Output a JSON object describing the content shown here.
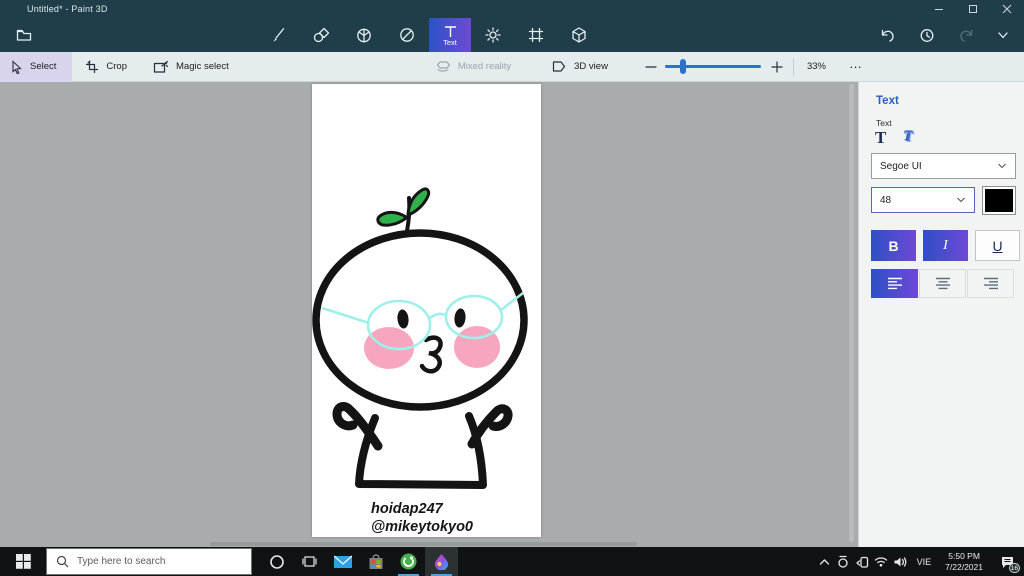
{
  "window": {
    "title": "Untitled* - Paint 3D"
  },
  "ribbon": {
    "text_tool_label": "Text",
    "tools": [
      "menu",
      "brushes",
      "2d-shapes",
      "3d-shapes",
      "stickers",
      "text",
      "effects",
      "canvas",
      "3d-library"
    ],
    "history_icons": [
      "undo",
      "history",
      "redo",
      "expand"
    ]
  },
  "subtoolbar": {
    "select": "Select",
    "crop": "Crop",
    "magic_select": "Magic select",
    "mixed_reality": "Mixed reality",
    "view_3d": "3D view",
    "zoom_percent": "33%",
    "more": "…"
  },
  "right_panel": {
    "header": "Text",
    "section_label": "Text",
    "font_family_value": "Segoe UI",
    "font_size_value": "48",
    "bold_label": "B",
    "italic_label": "I",
    "underline_label": "U",
    "text_color": "#000000",
    "accent_color": "#2e50c4"
  },
  "canvas": {
    "caption_line1": "hoidap247",
    "caption_line2": "@mikeytokyo0",
    "colors": {
      "outline": "#141414",
      "cheek": "#f7a6bf",
      "glasses": "#9ff0e8",
      "leaf": "#2fb14c",
      "background": "#ffffff"
    }
  },
  "taskbar": {
    "search_placeholder": "Type here to search",
    "language": "VIE",
    "time": "5:50 PM",
    "date": "7/22/2021",
    "notification_count": "16",
    "icons": [
      "start",
      "search",
      "cortana",
      "task-view",
      "mail",
      "store",
      "coccoc-browser",
      "paint-3d",
      "tray-expand",
      "update",
      "phone",
      "network",
      "volume",
      "notifications"
    ]
  }
}
